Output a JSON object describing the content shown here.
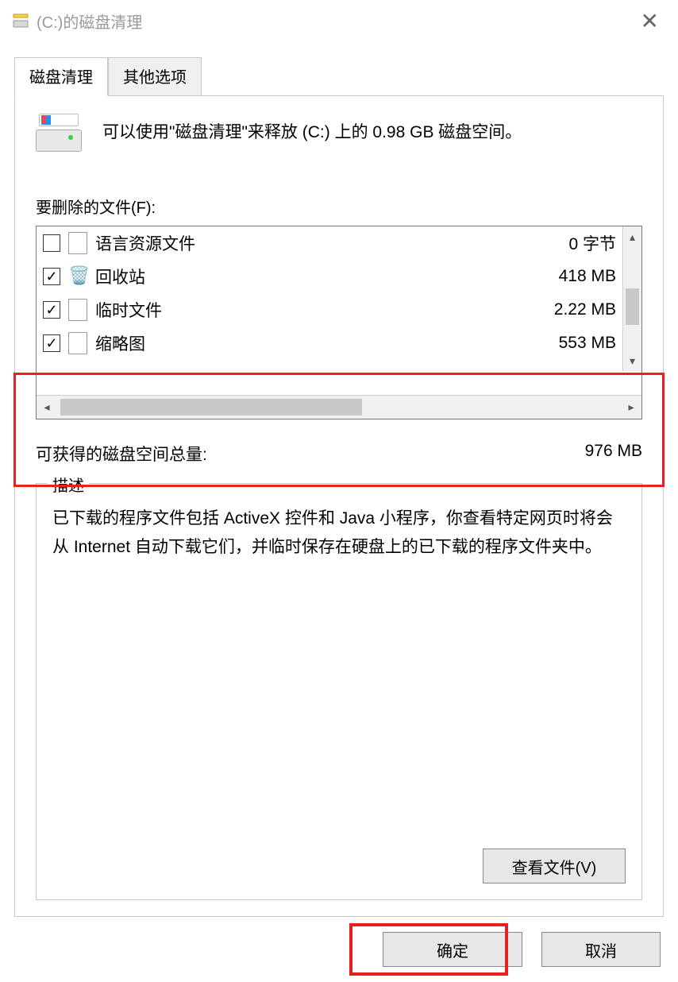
{
  "titlebar": {
    "title": "(C:)的磁盘清理"
  },
  "tabs": {
    "disk_cleanup": "磁盘清理",
    "other_options": "其他选项"
  },
  "intro": "可以使用\"磁盘清理\"来释放 (C:) 上的 0.98 GB 磁盘空间。",
  "files_label": "要删除的文件(F):",
  "file_items": [
    {
      "checked": false,
      "icon": "file",
      "name": "语言资源文件",
      "size": "0 字节"
    },
    {
      "checked": true,
      "icon": "recycle",
      "name": "回收站",
      "size": "418 MB"
    },
    {
      "checked": true,
      "icon": "file",
      "name": "临时文件",
      "size": "2.22 MB"
    },
    {
      "checked": true,
      "icon": "file",
      "name": "缩略图",
      "size": "553 MB"
    }
  ],
  "total": {
    "label": "可获得的磁盘空间总量:",
    "value": "976 MB"
  },
  "description": {
    "legend": "描述",
    "text": "已下载的程序文件包括 ActiveX 控件和 Java 小程序，你查看特定网页时将会从 Internet 自动下载它们，并临时保存在硬盘上的已下载的程序文件夹中。"
  },
  "buttons": {
    "view_files": "查看文件(V)",
    "ok": "确定",
    "cancel": "取消"
  }
}
